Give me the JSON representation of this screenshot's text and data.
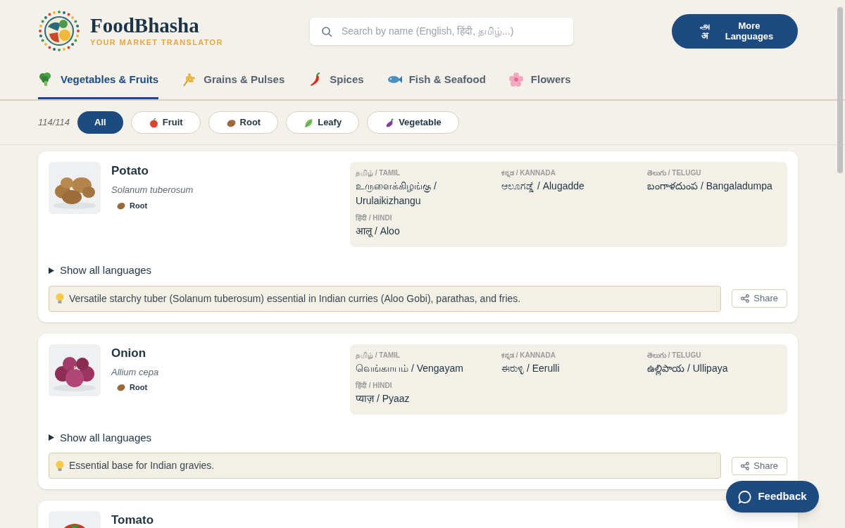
{
  "header": {
    "brand": "FoodBhasha",
    "tagline": "YOUR MARKET TRANSLATOR",
    "search": {
      "placeholder": "Search by name (English, हिंदी, தமிழ்...)"
    },
    "language_button": {
      "glyphs": [
        "அ",
        "अ"
      ],
      "label": "More Languages"
    }
  },
  "tabs": [
    {
      "label": "Vegetables & Fruits",
      "kind": "vegetables",
      "selected": true
    },
    {
      "label": "Grains & Pulses",
      "kind": "grains",
      "selected": false
    },
    {
      "label": "Spices",
      "kind": "spices",
      "selected": false
    },
    {
      "label": "Fish & Seafood",
      "kind": "fish",
      "selected": false
    },
    {
      "label": "Flowers",
      "kind": "flowers",
      "selected": false
    }
  ],
  "filters": {
    "count": "114/114",
    "chips": [
      {
        "label": "All",
        "selected": true
      },
      {
        "label": "Fruit",
        "kind": "fruit",
        "selected": false
      },
      {
        "label": "Root",
        "kind": "root",
        "selected": false
      },
      {
        "label": "Leafy",
        "kind": "leafy",
        "selected": false
      },
      {
        "label": "Vegetable",
        "kind": "vegetable",
        "selected": false
      }
    ]
  },
  "items": [
    {
      "name": "Potato",
      "scientific": "Solanum tuberosum",
      "category": {
        "label": "Root",
        "kind": "root"
      },
      "translations": [
        {
          "label": "தமிழ் / TAMIL",
          "value": "உருளைக்கிழங்கு / Urulaikizhangu"
        },
        {
          "label": "ಕನ್ನಡ / KANNADA",
          "value": "ಆಲೂಗಡ್ಡೆ / Alugadde"
        },
        {
          "label": "తెలుగు / TELUGU",
          "value": "బంగాళదుంప / Bangaladumpa"
        },
        {
          "label": "हिंदी / HINDI",
          "value": "आलू / Aloo"
        }
      ],
      "toggle": "Show all languages",
      "tip": "Versatile starchy tuber (Solanum tuberosum) essential in Indian curries (Aloo Gobi), parathas, and fries.",
      "share": "Share"
    },
    {
      "name": "Onion",
      "scientific": "Allium cepa",
      "category": {
        "label": "Root",
        "kind": "root"
      },
      "translations": [
        {
          "label": "தமிழ் / TAMIL",
          "value": "வெங்காயம் / Vengayam"
        },
        {
          "label": "ಕನ್ನಡ / KANNADA",
          "value": "ಈರುಳ್ಳಿ / Eerulli"
        },
        {
          "label": "తెలుగు / TELUGU",
          "value": "ఉల్లిపాయ / Ullipaya"
        },
        {
          "label": "हिंदी / HINDI",
          "value": "प्याज़ / Pyaaz"
        }
      ],
      "toggle": "Show all languages",
      "tip": "Essential base for Indian gravies.",
      "share": "Share"
    },
    {
      "name": "Tomato"
    }
  ],
  "feedback": {
    "label": "Feedback"
  }
}
